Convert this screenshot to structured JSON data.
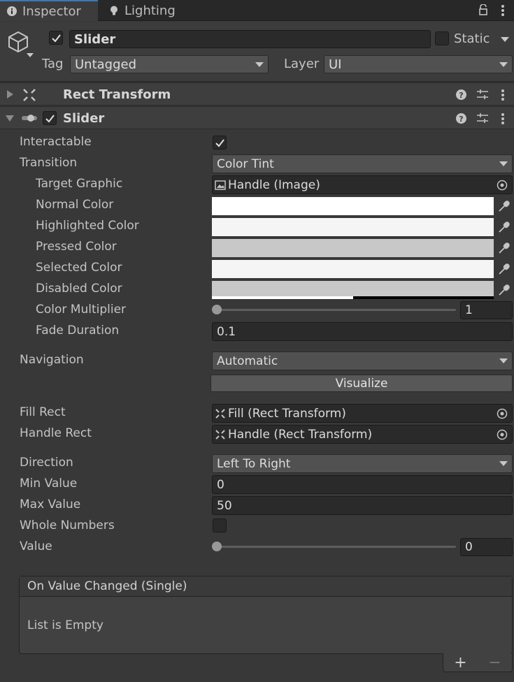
{
  "tabs": [
    {
      "label": "Inspector",
      "icon": "info-icon"
    },
    {
      "label": "Lighting",
      "icon": "lightbulb-icon"
    }
  ],
  "header": {
    "object_name": "Slider",
    "static_label": "Static",
    "tag_label": "Tag",
    "tag_value": "Untagged",
    "layer_label": "Layer",
    "layer_value": "UI"
  },
  "components": {
    "rect_transform": "Rect Transform",
    "slider": "Slider"
  },
  "fields": {
    "interactable": "Interactable",
    "transition": "Transition",
    "transition_value": "Color Tint",
    "target_graphic": "Target Graphic",
    "target_graphic_value": "Handle (Image)",
    "normal_color": "Normal Color",
    "highlighted_color": "Highlighted Color",
    "pressed_color": "Pressed Color",
    "selected_color": "Selected Color",
    "disabled_color": "Disabled Color",
    "color_multiplier": "Color Multiplier",
    "color_multiplier_value": "1",
    "fade_duration": "Fade Duration",
    "fade_duration_value": "0.1",
    "navigation": "Navigation",
    "navigation_value": "Automatic",
    "visualize": "Visualize",
    "fill_rect": "Fill Rect",
    "fill_rect_value": "Fill (Rect Transform)",
    "handle_rect": "Handle Rect",
    "handle_rect_value": "Handle (Rect Transform)",
    "direction": "Direction",
    "direction_value": "Left To Right",
    "min_value": "Min Value",
    "min_value_value": "0",
    "max_value": "Max Value",
    "max_value_value": "50",
    "whole_numbers": "Whole Numbers",
    "value": "Value",
    "value_value": "0"
  },
  "colors": {
    "normal": "#ffffff",
    "highlighted": "#f5f5f5",
    "pressed": "#c8c8c8",
    "selected": "#f5f5f5",
    "disabled": "#c8c8c8",
    "accent": "#3a79bb"
  },
  "event": {
    "title": "On Value Changed (Single)",
    "empty": "List is Empty",
    "plus": "+",
    "minus": "−"
  }
}
